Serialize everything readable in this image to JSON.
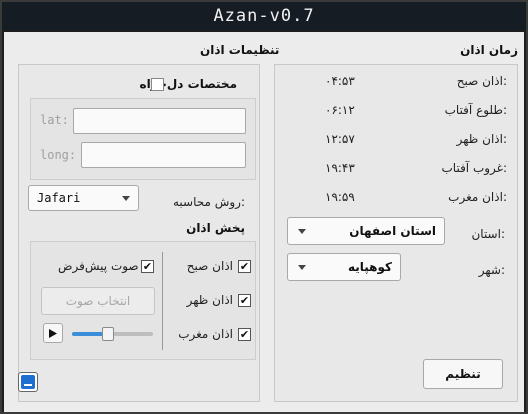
{
  "window": {
    "title": "Azan-v0.7"
  },
  "times_section": {
    "heading": "زمان اذان",
    "rows": [
      {
        "label": "اذان صبح:",
        "time": "۰۴:۵۳"
      },
      {
        "label": "طلوع آفتاب:",
        "time": "۰۶:۱۲"
      },
      {
        "label": "اذان ظهر:",
        "time": "۱۲:۵۷"
      },
      {
        "label": "غروب آفتاب:",
        "time": "۱۹:۴۳"
      },
      {
        "label": "اذان مغرب:",
        "time": "۱۹:۵۹"
      }
    ],
    "province_label": "استان:",
    "province_value": "استان اصفهان",
    "city_label": "شهر:",
    "city_value": "کوهپایه",
    "set_button": "تنظیم"
  },
  "settings_section": {
    "heading": "تنظیمات اذان",
    "custom_coords_label": "مختصات دل‌خواه",
    "custom_coords_checked": false,
    "lat_label": "lat:",
    "lat_value": "",
    "long_label": "long:",
    "long_value": "",
    "calc_method_label": "روش محاسبه:",
    "calc_method_value": "Jafari",
    "playback_heading": "پخش اذان",
    "azan_checks": [
      {
        "label": "اذان صبح",
        "checked": true
      },
      {
        "label": "اذان ظهر",
        "checked": true
      },
      {
        "label": "اذان مغرب",
        "checked": true
      }
    ],
    "default_sound_label": "صوت پیش‌فرض",
    "default_sound_checked": true,
    "choose_sound_button": "انتخاب صوت",
    "play_icon": "play-icon",
    "volume_level": 0.45,
    "minimize_icon": "minimize-icon"
  },
  "colors": {
    "titlebar": "#161c24",
    "accent": "#3b8fd9",
    "minimize_button": "#1e6fd0"
  }
}
